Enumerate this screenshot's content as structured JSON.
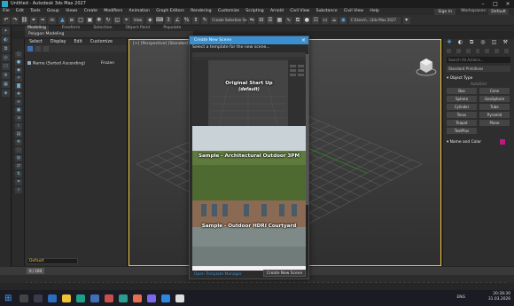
{
  "window": {
    "title": "Untitled - Autodesk 3ds Max 2027"
  },
  "menu": {
    "items": [
      "File",
      "Edit",
      "Tools",
      "Group",
      "Views",
      "Create",
      "Modifiers",
      "Animation",
      "Graph Editors",
      "Rendering",
      "Customize",
      "Scripting",
      "Arnold",
      "Civil View",
      "Substance",
      "Civil View",
      "Help"
    ],
    "user": "Sign In",
    "workspaces_label": "Workspaces:",
    "workspace_value": "Default"
  },
  "toolbar": {
    "filter_value": "All",
    "selection_set": "Create Selection Se",
    "view_value": "View",
    "path_value": "C:\\Users\\...\\3ds Max 2027"
  },
  "ribbon": {
    "tabs": [
      "Modeling",
      "Freeform",
      "Selection",
      "Object Paint",
      "Populate"
    ],
    "active_subtab": "Polygon Modeling"
  },
  "explorer": {
    "tabs": [
      "Select",
      "Display",
      "Edit",
      "Customize"
    ],
    "rows": [
      {
        "name": "Name (Sorted Ascending)",
        "frozen": "Frozen"
      }
    ],
    "layer": "Default"
  },
  "viewport": {
    "label": "[+] [Perspective] [Standard] [Default Shading]"
  },
  "command_panel": {
    "search_placeholder": "Search All Actions...",
    "dropdown": "Standard Primitives",
    "object_type_title": "Object Type",
    "autogrid": "AutoGrid",
    "buttons": [
      "Box",
      "Cone",
      "Sphere",
      "GeoSphere",
      "Cylinder",
      "Tube",
      "Torus",
      "Pyramid",
      "Teapot",
      "Plane",
      "TextPlus"
    ],
    "name_color_title": "Name and Color",
    "swatch_color": "#c01880"
  },
  "dialog": {
    "title": "Create New Scene",
    "prompt": "Select a template for the new scene...",
    "templates": [
      {
        "name": "Original Start Up",
        "tag": "(default)"
      },
      {
        "name": "Sample - Architectural Outdoor 3PM"
      },
      {
        "name": "Sample - Outdoor HDRI Courtyard"
      }
    ],
    "footer_link": "Open Template Manager",
    "create_button": "Create New Scene"
  },
  "timeline": {
    "frame_label": "0 / 100"
  },
  "taskbar": {
    "language": "ENG",
    "time": "20:28:30",
    "date": "31.03.2026"
  },
  "colors": {
    "accent_blue": "#3a8fd0",
    "viewport_border": "#f0c040"
  }
}
